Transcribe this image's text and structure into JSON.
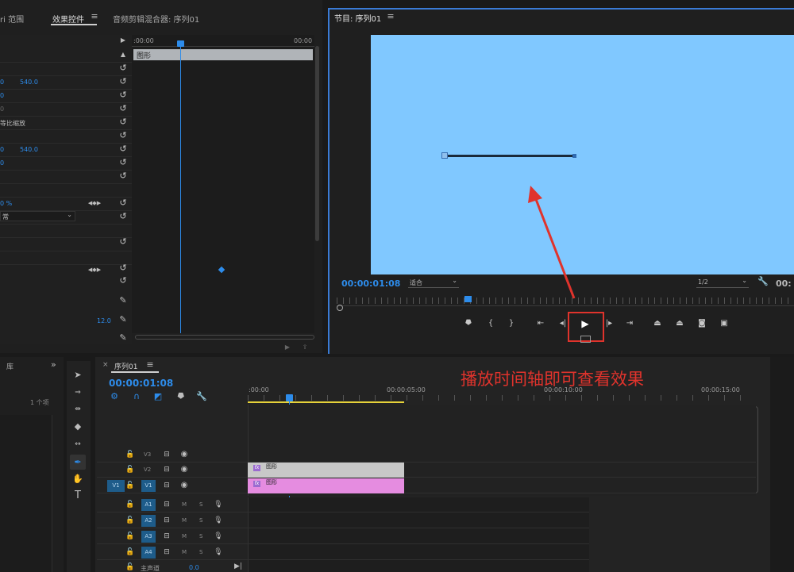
{
  "source_panel": {
    "tabs": [
      "ri 范围",
      "效果控件",
      "音频剪辑混合器: 序列01"
    ],
    "active_tab": "效果控件",
    "menu_icon": "hamburger-icon",
    "timeline_start": ":00:00",
    "timeline_end": "00:00",
    "clip_bar_label": "图形",
    "values": {
      "pos_x": "0",
      "pos_y": "540.0",
      "scale": "0",
      "scale_pct": "0",
      "uniform_scale": "等比缩放",
      "anchor_x": "0",
      "anchor_y": "540.0",
      "rotation": "0",
      "opacity": "0 %",
      "blend_mode": "常",
      "bottom_value": "12.0"
    }
  },
  "program_monitor": {
    "title": "节目: 序列01",
    "timecode": "00:00:01:08",
    "fit_label": "适合",
    "quality": "1/2",
    "right_timecode": "00:"
  },
  "annotation": {
    "text": "播放时间轴即可查看效果",
    "color": "#e0332c"
  },
  "project_panel": {
    "tab": "库",
    "item_count": "1 个项"
  },
  "timeline": {
    "tab": "序列01",
    "timecode": "00:00:01:08",
    "ruler": [
      ":00:00",
      "00:00:05:00",
      "00:00:10:00",
      "00:00:15:00"
    ],
    "video_tracks": [
      {
        "name": "V3",
        "toggle": ""
      },
      {
        "name": "V2",
        "toggle": ""
      },
      {
        "name": "V1",
        "toggle": "V1"
      }
    ],
    "audio_tracks": [
      "A1",
      "A2",
      "A3",
      "A4"
    ],
    "audio_m": "M",
    "audio_s": "S",
    "master_label": "主声道",
    "master_value": "0.0",
    "clips": [
      {
        "label": "图形",
        "color": "#c8c8c8"
      },
      {
        "label": "图形",
        "color": "#e58ce0"
      }
    ]
  },
  "colors": {
    "accent": "#2d8ceb",
    "program_bg": "#80c8ff",
    "clip_pink": "#e58ce0"
  }
}
